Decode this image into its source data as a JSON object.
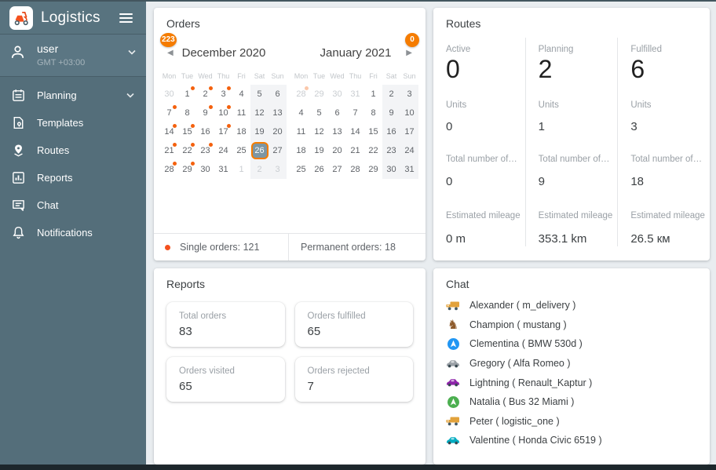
{
  "colors": {
    "accent": "#f57c00",
    "dot": "#f4610e",
    "selected_day_bg": "#7d96a3",
    "sidebar": "#546e7a"
  },
  "sidebar": {
    "app_title": "Logistics",
    "user": {
      "name": "user",
      "timezone": "GMT +03:00"
    },
    "items": [
      {
        "label": "Planning",
        "icon": "calendar-icon",
        "expandable": true
      },
      {
        "label": "Templates",
        "icon": "template-icon",
        "expandable": false
      },
      {
        "label": "Routes",
        "icon": "route-pin-icon",
        "expandable": false
      },
      {
        "label": "Reports",
        "icon": "bar-chart-icon",
        "expandable": false
      },
      {
        "label": "Chat",
        "icon": "chat-icon",
        "expandable": false
      },
      {
        "label": "Notifications",
        "icon": "bell-icon",
        "expandable": false
      }
    ]
  },
  "orders": {
    "title": "Orders",
    "months": [
      {
        "name": "December 2020",
        "badge": "223",
        "nav": "prev",
        "weekdays": [
          "Mon",
          "Tue",
          "Wed",
          "Thu",
          "Fri",
          "Sat",
          "Sun"
        ],
        "days": [
          [
            30,
            "m"
          ],
          [
            1,
            "d"
          ],
          [
            2,
            "d"
          ],
          [
            3,
            "d"
          ],
          [
            4,
            ""
          ],
          [
            5,
            ""
          ],
          [
            6,
            ""
          ],
          [
            7,
            "d"
          ],
          [
            8,
            ""
          ],
          [
            9,
            "d"
          ],
          [
            10,
            "d"
          ],
          [
            11,
            ""
          ],
          [
            12,
            ""
          ],
          [
            13,
            ""
          ],
          [
            14,
            "d"
          ],
          [
            15,
            "d"
          ],
          [
            16,
            ""
          ],
          [
            17,
            "d"
          ],
          [
            18,
            ""
          ],
          [
            19,
            ""
          ],
          [
            20,
            ""
          ],
          [
            21,
            "d"
          ],
          [
            22,
            "d"
          ],
          [
            23,
            "d"
          ],
          [
            24,
            ""
          ],
          [
            25,
            ""
          ],
          [
            26,
            "s"
          ],
          [
            27,
            ""
          ],
          [
            28,
            "d"
          ],
          [
            29,
            "d"
          ],
          [
            30,
            ""
          ],
          [
            31,
            ""
          ],
          [
            1,
            "m"
          ],
          [
            2,
            "m"
          ],
          [
            3,
            "m"
          ]
        ]
      },
      {
        "name": "January 2021",
        "badge": "0",
        "nav": "next",
        "weekdays": [
          "Mon",
          "Tue",
          "Wed",
          "Thu",
          "Fri",
          "Sat",
          "Sun"
        ],
        "days": [
          [
            28,
            "mf"
          ],
          [
            29,
            "m"
          ],
          [
            30,
            "m"
          ],
          [
            31,
            "m"
          ],
          [
            1,
            ""
          ],
          [
            2,
            ""
          ],
          [
            3,
            ""
          ],
          [
            4,
            ""
          ],
          [
            5,
            ""
          ],
          [
            6,
            ""
          ],
          [
            7,
            ""
          ],
          [
            8,
            ""
          ],
          [
            9,
            ""
          ],
          [
            10,
            ""
          ],
          [
            11,
            ""
          ],
          [
            12,
            ""
          ],
          [
            13,
            ""
          ],
          [
            14,
            ""
          ],
          [
            15,
            ""
          ],
          [
            16,
            ""
          ],
          [
            17,
            ""
          ],
          [
            18,
            ""
          ],
          [
            19,
            ""
          ],
          [
            20,
            ""
          ],
          [
            21,
            ""
          ],
          [
            22,
            ""
          ],
          [
            23,
            ""
          ],
          [
            24,
            ""
          ],
          [
            25,
            ""
          ],
          [
            26,
            ""
          ],
          [
            27,
            ""
          ],
          [
            28,
            ""
          ],
          [
            29,
            ""
          ],
          [
            30,
            ""
          ],
          [
            31,
            ""
          ]
        ]
      }
    ],
    "footer": {
      "single_label": "Single orders: 121",
      "permanent_label": "Permanent orders: 18"
    }
  },
  "routes": {
    "title": "Routes",
    "columns": [
      {
        "status": "Active",
        "count": "0",
        "units_label": "Units",
        "units": "0",
        "orders_label": "Total number of or…",
        "orders": "0",
        "mileage_label": "Estimated mileage",
        "mileage": "0 m"
      },
      {
        "status": "Planning",
        "count": "2",
        "units_label": "Units",
        "units": "1",
        "orders_label": "Total number of or…",
        "orders": "9",
        "mileage_label": "Estimated mileage",
        "mileage": "353.1 km"
      },
      {
        "status": "Fulfilled",
        "count": "6",
        "units_label": "Units",
        "units": "3",
        "orders_label": "Total number of or…",
        "orders": "18",
        "mileage_label": "Estimated mileage",
        "mileage": "26.5 км"
      }
    ]
  },
  "reports": {
    "title": "Reports",
    "cards": [
      {
        "label": "Total orders",
        "value": "83"
      },
      {
        "label": "Orders fulfilled",
        "value": "65"
      },
      {
        "label": "Orders visited",
        "value": "65"
      },
      {
        "label": "Orders rejected",
        "value": "7"
      }
    ]
  },
  "chat": {
    "title": "Chat",
    "contacts": [
      {
        "name": "Alexander ( m_delivery )",
        "icon": "truck-icon",
        "color": "#e2a23b"
      },
      {
        "name": "Champion ( mustang )",
        "icon": "horse-icon",
        "color": "#8d5a2b"
      },
      {
        "name": "Clementina ( BMW 530d )",
        "icon": "navigation-icon",
        "color": "#2196f3"
      },
      {
        "name": "Gregory ( Alfa Romeo )",
        "icon": "car-icon",
        "color": "#9aa0a6"
      },
      {
        "name": "Lightning ( Renault_Kaptur )",
        "icon": "car-icon",
        "color": "#8e24aa"
      },
      {
        "name": "Natalia ( Bus 32 Miami )",
        "icon": "navigation-icon",
        "color": "#4caf50"
      },
      {
        "name": "Peter ( logistic_one )",
        "icon": "truck-icon",
        "color": "#e2a23b"
      },
      {
        "name": "Valentine ( Honda Civic 6519 )",
        "icon": "car-icon",
        "color": "#00acc1"
      }
    ]
  }
}
